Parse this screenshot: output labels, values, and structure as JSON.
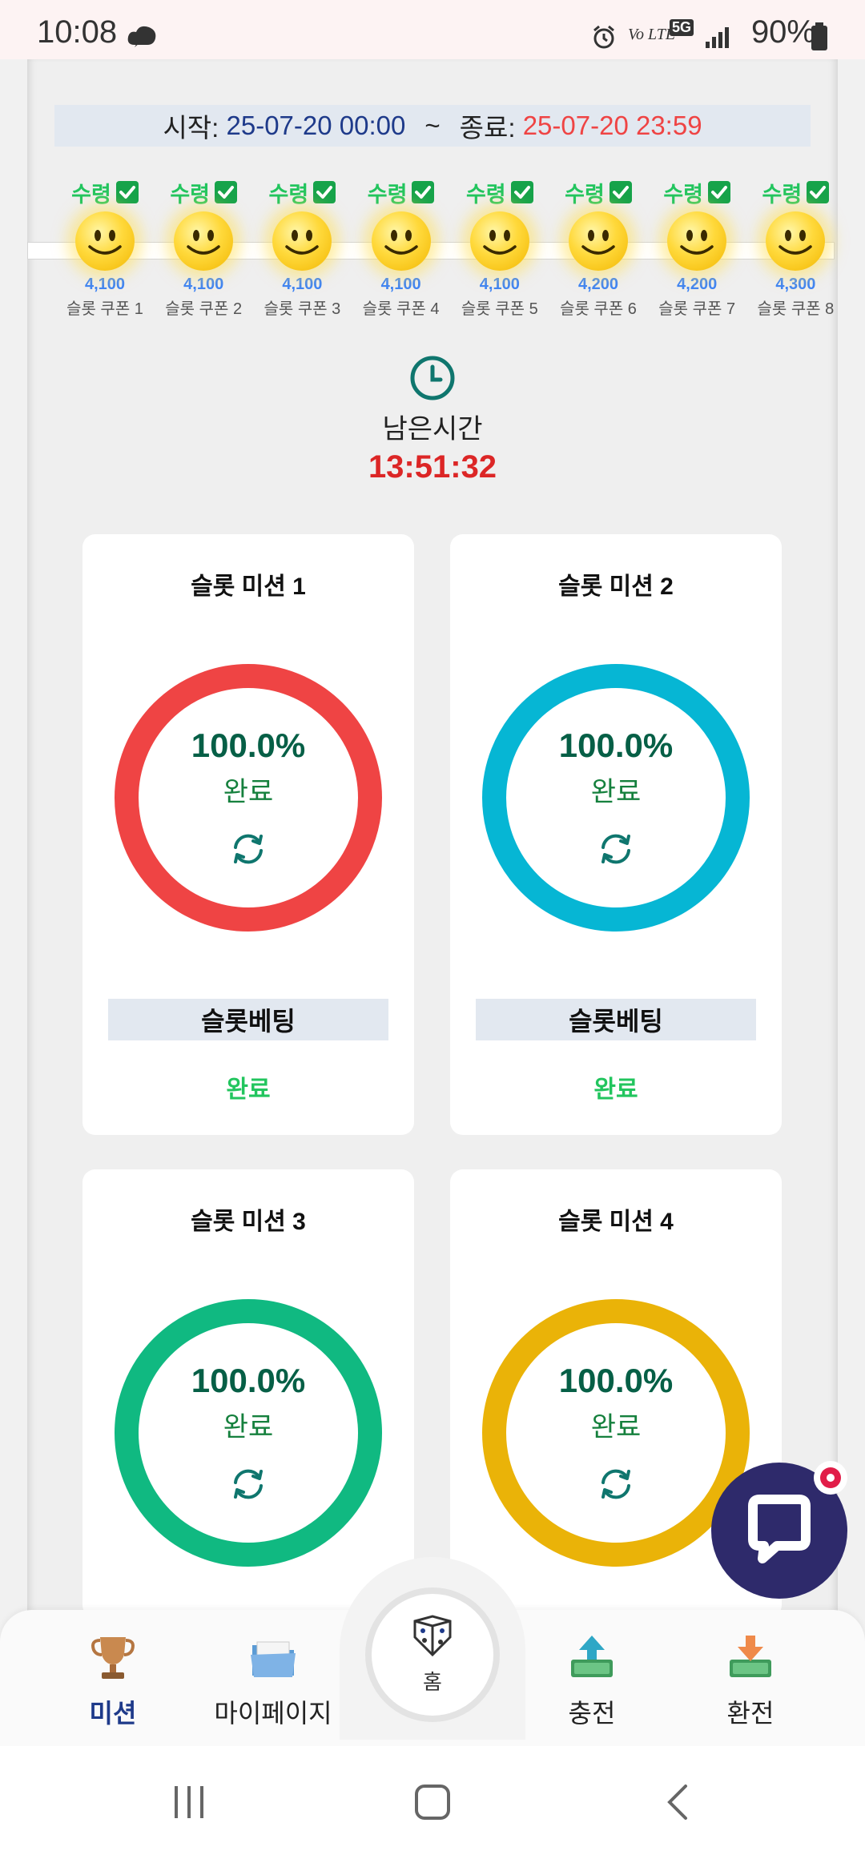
{
  "status_bar": {
    "time": "10:08",
    "carrier": "Vo LTE",
    "network": "5G",
    "battery": "90%"
  },
  "period": {
    "start_label": "시작:",
    "start_value": "25-07-20 00:00",
    "separator": "~",
    "end_label": "종료:",
    "end_value": "25-07-20 23:59"
  },
  "coupons": [
    {
      "status": "수령",
      "amount": "4,100",
      "name": "슬롯 쿠폰 1"
    },
    {
      "status": "수령",
      "amount": "4,100",
      "name": "슬롯 쿠폰 2"
    },
    {
      "status": "수령",
      "amount": "4,100",
      "name": "슬롯 쿠폰 3"
    },
    {
      "status": "수령",
      "amount": "4,100",
      "name": "슬롯 쿠폰 4"
    },
    {
      "status": "수령",
      "amount": "4,100",
      "name": "슬롯 쿠폰 5"
    },
    {
      "status": "수령",
      "amount": "4,200",
      "name": "슬롯 쿠폰 6"
    },
    {
      "status": "수령",
      "amount": "4,200",
      "name": "슬롯 쿠폰 7"
    },
    {
      "status": "수령",
      "amount": "4,300",
      "name": "슬롯 쿠폰 8"
    }
  ],
  "timer": {
    "label": "남은시간",
    "value": "13:51:32"
  },
  "missions": [
    {
      "title": "슬롯 미션 1",
      "percent": "100.0%",
      "state": "완료",
      "bet_label": "슬롯베팅",
      "bet_status": "완료",
      "color": "#ef4444"
    },
    {
      "title": "슬롯 미션 2",
      "percent": "100.0%",
      "state": "완료",
      "bet_label": "슬롯베팅",
      "bet_status": "완료",
      "color": "#06b6d4"
    },
    {
      "title": "슬롯 미션 3",
      "percent": "100.0%",
      "state": "완료",
      "color": "#10b981"
    },
    {
      "title": "슬롯 미션 4",
      "percent": "100.0%",
      "state": "완료",
      "color": "#eab308"
    }
  ],
  "bottom_nav": {
    "mission": "미션",
    "mypage": "마이페이지",
    "home": "홈",
    "charge": "충전",
    "exchange": "환전"
  },
  "icons": {
    "chat": "chat-bubble-icon",
    "clock": "clock-icon",
    "refresh": "refresh-icon"
  }
}
